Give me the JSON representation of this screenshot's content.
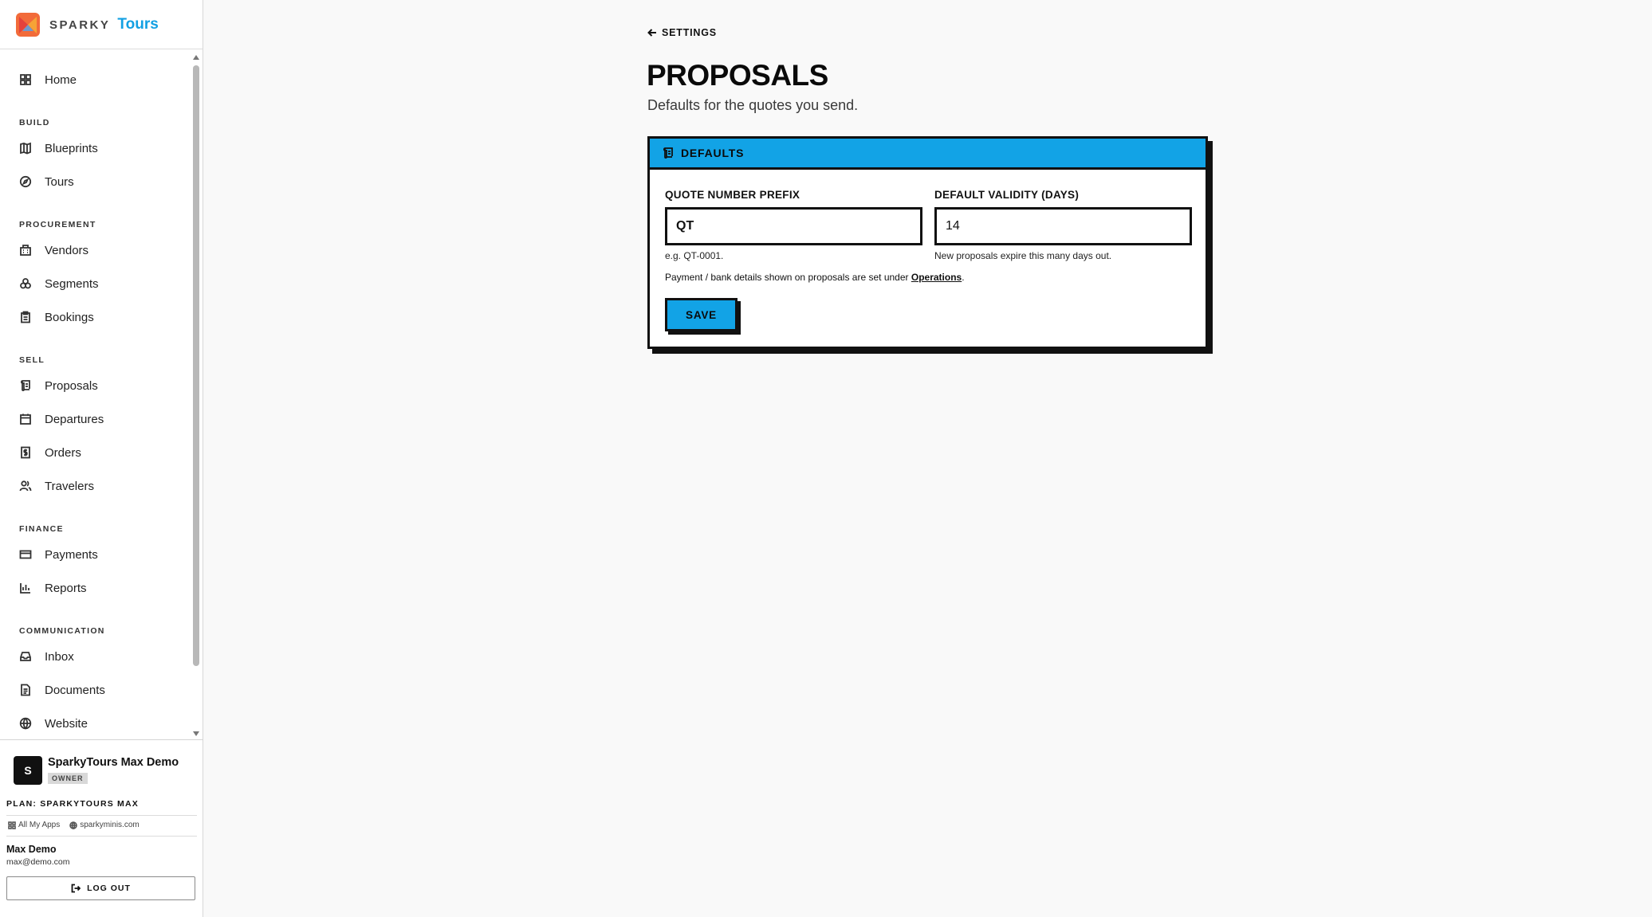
{
  "brand": {
    "word1": "SPARKY",
    "word2": "Tours",
    "accent": "#12a0e3",
    "logo_colors": [
      "#ef4444",
      "#f59e0b",
      "#3b82f6"
    ]
  },
  "nav": {
    "home": "Home",
    "sections": {
      "build": "BUILD",
      "procurement": "PROCUREMENT",
      "sell": "SELL",
      "finance": "FINANCE",
      "communication": "COMMUNICATION"
    },
    "items": {
      "blueprints": "Blueprints",
      "tours": "Tours",
      "vendors": "Vendors",
      "segments": "Segments",
      "bookings": "Bookings",
      "proposals": "Proposals",
      "departures": "Departures",
      "orders": "Orders",
      "travelers": "Travelers",
      "payments": "Payments",
      "reports": "Reports",
      "inbox": "Inbox",
      "documents": "Documents",
      "website": "Website"
    }
  },
  "account": {
    "avatar_letter": "S",
    "org_name": "SparkyTours Max Demo",
    "role_badge": "OWNER",
    "plan": "PLAN: SPARKYTOURS MAX",
    "all_apps": "All My Apps",
    "site_link": "sparkyminis.com",
    "user_name": "Max Demo",
    "user_email": "max@demo.com",
    "logout": "LOG OUT"
  },
  "main": {
    "back_label": "SETTINGS",
    "title": "PROPOSALS",
    "subtitle": "Defaults for the quotes you send.",
    "card_title": "DEFAULTS",
    "prefix_label": "QUOTE NUMBER PREFIX",
    "prefix_value": "QT",
    "prefix_hint": "e.g. QT-0001.",
    "validity_label": "DEFAULT VALIDITY (DAYS)",
    "validity_value": "14",
    "validity_hint": "New proposals expire this many days out.",
    "note_text": "Payment / bank details shown on proposals are set under ",
    "note_link": "Operations",
    "note_end": ".",
    "save": "SAVE",
    "accent": "#12a3e6"
  }
}
